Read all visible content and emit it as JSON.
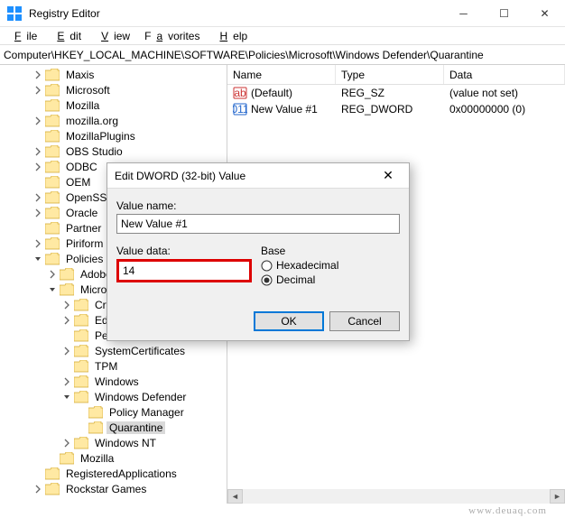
{
  "window": {
    "title": "Registry Editor"
  },
  "menu": {
    "file": "File",
    "edit": "Edit",
    "view": "View",
    "favorites": "Favorites",
    "help": "Help"
  },
  "address": "Computer\\HKEY_LOCAL_MACHINE\\SOFTWARE\\Policies\\Microsoft\\Windows Defender\\Quarantine",
  "tree": [
    {
      "d": 2,
      "tw": ">",
      "label": "Maxis"
    },
    {
      "d": 2,
      "tw": ">",
      "label": "Microsoft"
    },
    {
      "d": 2,
      "tw": "",
      "label": "Mozilla"
    },
    {
      "d": 2,
      "tw": ">",
      "label": "mozilla.org"
    },
    {
      "d": 2,
      "tw": "",
      "label": "MozillaPlugins"
    },
    {
      "d": 2,
      "tw": ">",
      "label": "OBS Studio"
    },
    {
      "d": 2,
      "tw": ">",
      "label": "ODBC"
    },
    {
      "d": 2,
      "tw": "",
      "label": "OEM"
    },
    {
      "d": 2,
      "tw": ">",
      "label": "OpenSSH"
    },
    {
      "d": 2,
      "tw": ">",
      "label": "Oracle"
    },
    {
      "d": 2,
      "tw": "",
      "label": "Partner"
    },
    {
      "d": 2,
      "tw": ">",
      "label": "Piriform"
    },
    {
      "d": 2,
      "tw": "v",
      "label": "Policies"
    },
    {
      "d": 3,
      "tw": ">",
      "label": "Adobe"
    },
    {
      "d": 3,
      "tw": "v",
      "label": "Microsoft"
    },
    {
      "d": 4,
      "tw": ">",
      "label": "Cryptography"
    },
    {
      "d": 4,
      "tw": ">",
      "label": "Edge"
    },
    {
      "d": 4,
      "tw": "",
      "label": "Peernet"
    },
    {
      "d": 4,
      "tw": ">",
      "label": "SystemCertificates"
    },
    {
      "d": 4,
      "tw": "",
      "label": "TPM"
    },
    {
      "d": 4,
      "tw": ">",
      "label": "Windows"
    },
    {
      "d": 4,
      "tw": "v",
      "label": "Windows Defender"
    },
    {
      "d": 5,
      "tw": "",
      "label": "Policy Manager"
    },
    {
      "d": 5,
      "tw": "",
      "label": "Quarantine",
      "sel": true
    },
    {
      "d": 4,
      "tw": ">",
      "label": "Windows NT"
    },
    {
      "d": 3,
      "tw": "",
      "label": "Mozilla"
    },
    {
      "d": 2,
      "tw": "",
      "label": "RegisteredApplications"
    },
    {
      "d": 2,
      "tw": ">",
      "label": "Rockstar Games"
    }
  ],
  "list": {
    "columns": {
      "name": "Name",
      "type": "Type",
      "data": "Data"
    },
    "rows": [
      {
        "icon": "sz",
        "name": "(Default)",
        "type": "REG_SZ",
        "data": "(value not set)"
      },
      {
        "icon": "dw",
        "name": "New Value #1",
        "type": "REG_DWORD",
        "data": "0x00000000 (0)"
      }
    ]
  },
  "dialog": {
    "title": "Edit DWORD (32-bit) Value",
    "value_name_label": "Value name:",
    "value_name": "New Value #1",
    "value_data_label": "Value data:",
    "value_data": "14",
    "base_label": "Base",
    "hex_label": "Hexadecimal",
    "dec_label": "Decimal",
    "selected_base": "Decimal",
    "ok": "OK",
    "cancel": "Cancel"
  },
  "watermark": "www.deuaq.com"
}
